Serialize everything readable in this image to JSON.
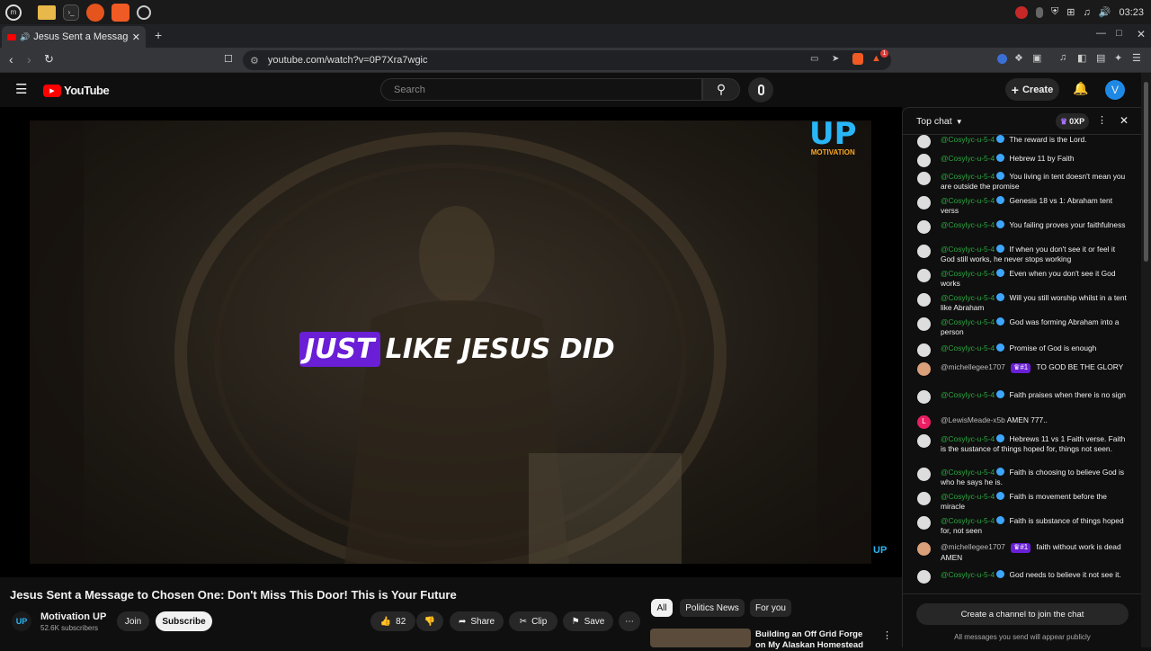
{
  "os": {
    "clock": "03:23"
  },
  "browser": {
    "tab_title": "Jesus Sent a Message to C",
    "url": "youtube.com/watch?v=0P7Xra7wgic",
    "new_tab": "+",
    "extension_badge": "1"
  },
  "youtube": {
    "logo": "YouTube",
    "search_placeholder": "Search",
    "create_label": "Create",
    "avatar_letter": "V"
  },
  "video": {
    "overlay_highlight": "JUST",
    "overlay_rest": "LIKE JESUS DID",
    "watermark_top": "UP",
    "watermark_sub": "MOTIVATION",
    "corner_logo": "UP",
    "title": "Jesus Sent a Message to Chosen One: Don't Miss This Door! This is Your Future"
  },
  "channel": {
    "name": "Motivation UP",
    "subscribers": "52.6K subscribers",
    "avatar": "UP",
    "join_label": "Join",
    "subscribe_label": "Subscribe"
  },
  "actions": {
    "likes": "82",
    "share": "Share",
    "clip": "Clip",
    "save": "Save"
  },
  "chips": [
    "All",
    "Politics News",
    "For you"
  ],
  "recommendation": {
    "title": "Building an Off Grid Forge on My Alaskan Homestead"
  },
  "chat": {
    "header": "Top chat",
    "points": "0XP",
    "messages": [
      {
        "author": "@Cosylyc-u-5-4",
        "text": "The reward is the Lord.",
        "verified": true
      },
      {
        "author": "@Cosylyc-u-5-4",
        "text": "Hebrew 11 by Faith",
        "verified": true
      },
      {
        "author": "@Cosylyc-u-5-4",
        "text": "You living in tent doesn't mean you are outside the promise",
        "verified": true
      },
      {
        "author": "@Cosylyc-u-5-4",
        "text": "Genesis 18 vs 1: Abraham tent verss",
        "verified": true
      },
      {
        "author": "@Cosylyc-u-5-4",
        "text": "You failing proves your faithfulness",
        "verified": true
      },
      {
        "author": "@Cosylyc-u-5-4",
        "text": "If when you don't see it or feel it God still works, he never stops working",
        "verified": true
      },
      {
        "author": "@Cosylyc-u-5-4",
        "text": "Even when you don't see it God works",
        "verified": true
      },
      {
        "author": "@Cosylyc-u-5-4",
        "text": "Will you still worship whilst in a tent like Abraham",
        "verified": true
      },
      {
        "author": "@Cosylyc-u-5-4",
        "text": "God was forming Abraham into a person",
        "verified": true
      },
      {
        "author": "@Cosylyc-u-5-4",
        "text": "Promise of God is enough",
        "verified": true
      },
      {
        "author": "@michellegee1707",
        "text": "TO GOD BE THE GLORY",
        "badge": "#1"
      },
      {
        "author": "@Cosylyc-u-5-4",
        "text": "Faith praises when there is no sign",
        "verified": true
      },
      {
        "author": "@LewisMeade-x5b",
        "text": "AMEN 777..",
        "avatar_letter": "L"
      },
      {
        "author": "@Cosylyc-u-5-4",
        "text": "Hebrews 11 vs 1 Faith verse. Faith is the sustance of things hoped for, things not seen.",
        "verified": true
      },
      {
        "author": "@Cosylyc-u-5-4",
        "text": "Faith is choosing to believe God is who he says he is.",
        "verified": true
      },
      {
        "author": "@Cosylyc-u-5-4",
        "text": "Faith is movement before the miracle",
        "verified": true
      },
      {
        "author": "@Cosylyc-u-5-4",
        "text": "Faith is substance of things hoped for, not seen",
        "verified": true
      },
      {
        "author": "@michellegee1707",
        "text": "faith without work is dead AMEN",
        "badge": "#1"
      },
      {
        "author": "@Cosylyc-u-5-4",
        "text": "God needs to believe it not see it.",
        "verified": true
      }
    ],
    "join_prompt": "Create a channel to join the chat",
    "footer_note": "All messages you send will appear publicly"
  },
  "colors": {
    "accent": "#ff0000",
    "author_green": "#2ba640",
    "member_purple": "#6a1fd6",
    "overlay_bg": "#6a1fd6"
  }
}
